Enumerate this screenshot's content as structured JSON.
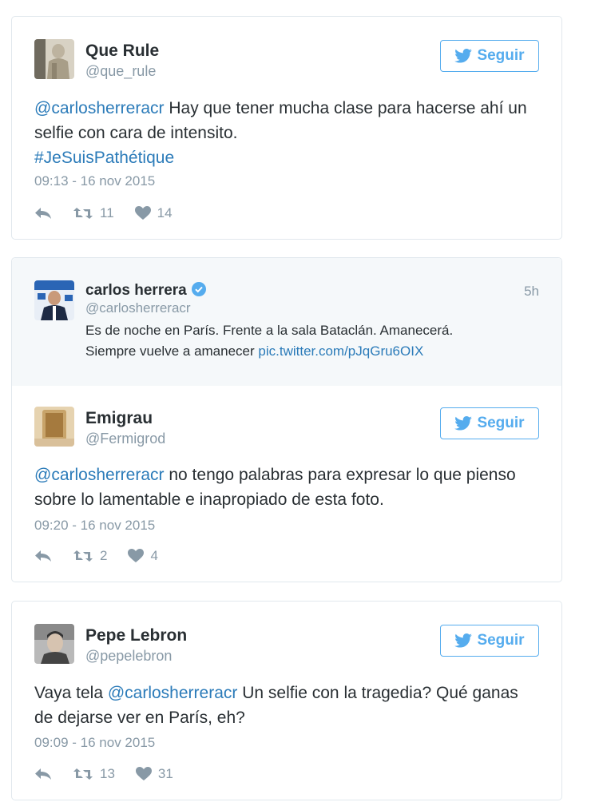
{
  "follow_label": "Seguir",
  "colors": {
    "accent": "#55acee",
    "link": "#2b7bb9",
    "muted": "#8899a6",
    "text": "#292f33",
    "border": "#e1e8ed"
  },
  "tweets": [
    {
      "name": "Que Rule",
      "handle": "@que_rule",
      "text": [
        {
          "t": "@carlosherreracr",
          "link": true
        },
        {
          "t": " Hay que tener mucha clase para hacerse ahí un selfie con cara de intensito.",
          "link": false
        },
        {
          "t": "#JeSuisPathétique",
          "link": true
        }
      ],
      "timestamp": "09:13 - 16 nov 2015",
      "retweets": "11",
      "likes": "14"
    },
    {
      "quoted": {
        "name": "carlos herrera",
        "handle": "@carlosherreracr",
        "time": "5h",
        "line1": "Es de noche en París. Frente a la sala Bataclán. Amanecerá.",
        "line2_text": "Siempre vuelve a amanecer ",
        "line2_link": "pic.twitter.com/pJqGru6OIX"
      },
      "name": "Emigrau",
      "handle": "@Fermigrod",
      "text_link": "@carlosherreracr",
      "text_rest": " no tengo palabras para expresar lo que pienso sobre lo lamentable e inapropiado de esta foto.",
      "timestamp": "09:20 - 16 nov 2015",
      "retweets": "2",
      "likes": "4"
    },
    {
      "name": "Pepe Lebron",
      "handle": "@pepelebron",
      "text_pre": "Vaya tela ",
      "text_link": "@carlosherreracr",
      "text_rest": " Un selfie con la tragedia? Qué ganas de dejarse ver en París, eh?",
      "timestamp": "09:09 - 16 nov 2015",
      "retweets": "13",
      "likes": "31"
    }
  ]
}
